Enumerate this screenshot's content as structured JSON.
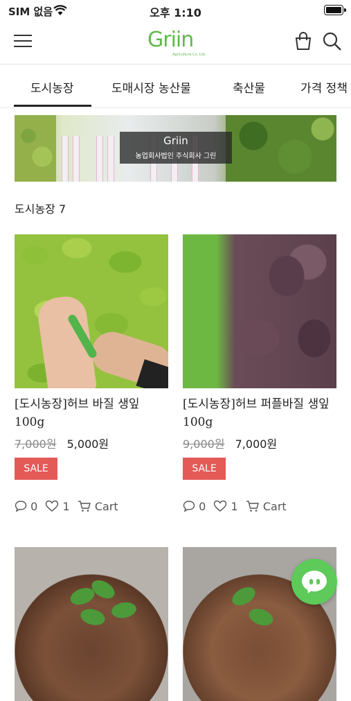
{
  "status_bar": {
    "carrier": "SIM 없음",
    "time": "오후 1:10"
  },
  "header": {
    "logo_text": "Griin",
    "logo_sub": "Agriculture Co. Ltd."
  },
  "tabs": [
    {
      "label": "도시농장",
      "active": true
    },
    {
      "label": "도매시장 농산물",
      "active": false
    },
    {
      "label": "축산물",
      "active": false
    },
    {
      "label": "가격 정책",
      "active": false
    }
  ],
  "banner": {
    "logo": "Griin",
    "caption": "농업회사법인 주식회사 그린"
  },
  "section": {
    "title": "도시농장 7"
  },
  "products": [
    {
      "name": "[도시농장]허브 바질 생잎 100g",
      "original_price": "7,000원",
      "sale_price": "5,000원",
      "badge": "SALE",
      "comments": "0",
      "likes": "1",
      "cart_label": "Cart"
    },
    {
      "name": "[도시농장]허브 퍼플바질 생잎 100g",
      "original_price": "9,000원",
      "sale_price": "7,000원",
      "badge": "SALE",
      "comments": "0",
      "likes": "1",
      "cart_label": "Cart"
    },
    {
      "name": "",
      "original_price": "",
      "sale_price": "",
      "badge": "",
      "comments": "",
      "likes": "",
      "cart_label": ""
    },
    {
      "name": "",
      "original_price": "",
      "sale_price": "",
      "badge": "",
      "comments": "",
      "likes": "",
      "cart_label": ""
    }
  ],
  "colors": {
    "brand_green": "#5fba4a",
    "sale_red": "#e35a57",
    "chat_green": "#5dca5a"
  },
  "icons": [
    "wifi-icon",
    "battery-icon",
    "menu-icon",
    "shopping-bag-icon",
    "search-icon",
    "comment-icon",
    "heart-icon",
    "cart-icon",
    "chat-icon"
  ]
}
